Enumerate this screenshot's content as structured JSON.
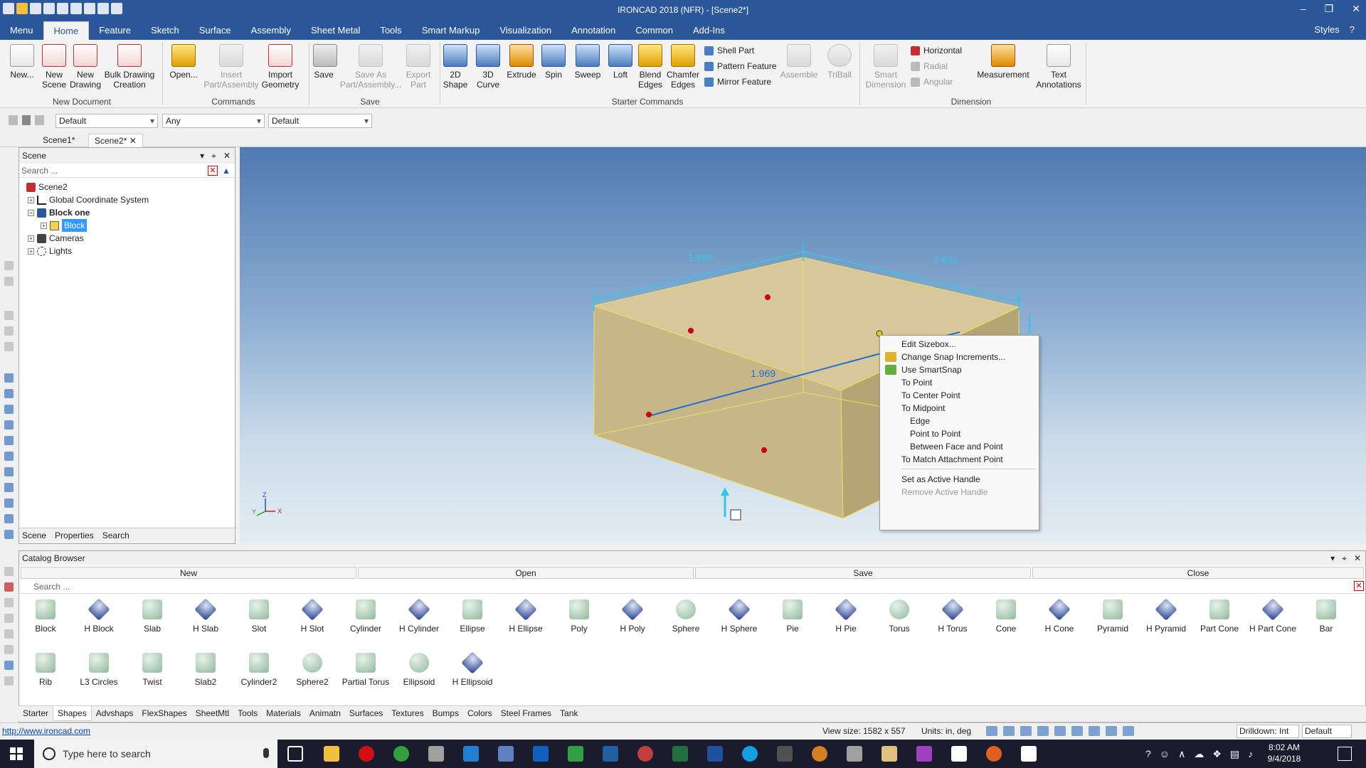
{
  "window": {
    "title": "IRONCAD 2018 (NFR) - [Scene2*]",
    "minimize": "–",
    "restore": "❐",
    "close": "✕"
  },
  "menubar": {
    "tabs": [
      "Menu",
      "Home",
      "Feature",
      "Sketch",
      "Surface",
      "Assembly",
      "Sheet Metal",
      "Tools",
      "Smart Markup",
      "Visualization",
      "Annotation",
      "Common",
      "Add-Ins"
    ],
    "active": "Home",
    "styles_label": "Styles",
    "help_label": "?"
  },
  "ribbon": {
    "new_document": {
      "group": "New Document",
      "new": "New...",
      "new_scene": [
        "New",
        "Scene"
      ],
      "new_drawing": [
        "New",
        "Drawing"
      ],
      "bulk": [
        "Bulk Drawing",
        "Creation"
      ]
    },
    "commands": {
      "group": "Commands",
      "open": "Open...",
      "insert": [
        "Insert",
        "Part/Assembly"
      ],
      "import": [
        "Import",
        "Geometry"
      ]
    },
    "save": {
      "group": "Save",
      "save": "Save",
      "save_as": [
        "Save As",
        "Part/Assembly..."
      ],
      "export": [
        "Export",
        "Part"
      ]
    },
    "starter": {
      "group": "Starter Commands",
      "shape2d": [
        "2D",
        "Shape"
      ],
      "curve3d": [
        "3D",
        "Curve"
      ],
      "extrude": "Extrude",
      "spin": "Spin",
      "sweep": "Sweep",
      "loft": "Loft",
      "blend": [
        "Blend",
        "Edges"
      ],
      "chamfer": [
        "Chamfer",
        "Edges"
      ],
      "shell": "Shell Part",
      "pattern": "Pattern Feature",
      "mirror": "Mirror Feature",
      "assemble": "Assemble",
      "triball": "TriBall"
    },
    "dimension": {
      "group": "Dimension",
      "smart": [
        "Smart",
        "Dimension"
      ],
      "horizontal": "Horizontal",
      "radial": "Radial",
      "angular": "Angular",
      "measurement": "Measurement",
      "text": [
        "Text",
        "Annotations"
      ]
    }
  },
  "toolrow": {
    "combo1": "Default",
    "combo2": "Any",
    "combo3": "Default"
  },
  "doc_tabs": [
    "Scene1*",
    "Scene2*"
  ],
  "scene_panel": {
    "title": "Scene",
    "search_placeholder": "Search ...",
    "tree": {
      "root": "Scene2",
      "gcs": "Global Coordinate System",
      "block_one": "Block one",
      "block": "Block",
      "cameras": "Cameras",
      "lights": "Lights"
    },
    "tabs": [
      "Scene",
      "Properties",
      "Search"
    ]
  },
  "viewport": {
    "dim_top_left": "1.969",
    "dim_top_right": "1.631",
    "dim_center": "1.969",
    "axis_z": "Z",
    "axis_x": "X",
    "axis_y": "Y"
  },
  "context_menu": {
    "edit_sizebox": "Edit Sizebox...",
    "change_snap": "Change Snap Increments...",
    "use_smartsnap": "Use SmartSnap",
    "to_point": "To Point",
    "to_center_point": "To Center Point",
    "to_midpoint": "To Midpoint",
    "edge": "Edge",
    "point_to_point": "Point to Point",
    "between_face_and_point": "Between Face and Point",
    "to_match_attachment": "To Match Attachment Point",
    "set_active_handle": "Set as Active Handle",
    "remove_active_handle": "Remove Active Handle"
  },
  "catalog": {
    "title": "Catalog Browser",
    "new": "New",
    "open": "Open",
    "save": "Save",
    "close": "Close",
    "search_placeholder": "Search ...",
    "shapes_row1": [
      "Block",
      "H Block",
      "Slab",
      "H Slab",
      "Slot",
      "H Slot",
      "Cylinder",
      "H Cylinder",
      "Ellipse",
      "H Ellipse",
      "Poly",
      "H Poly",
      "Sphere",
      "H Sphere",
      "Pie",
      "H Pie",
      "Torus",
      "H Torus",
      "Cone",
      "H Cone",
      "Pyramid",
      "H Pyramid",
      "Part Cone",
      "H Part Cone",
      "Bar"
    ],
    "shapes_row2": [
      "Rib",
      "L3 Circles",
      "Twist",
      "Slab2",
      "Cylinder2",
      "Sphere2",
      "Partial Torus",
      "Ellipsoid",
      "H Ellipsoid"
    ],
    "bottom_tabs": [
      "Starter",
      "Shapes",
      "Advshaps",
      "FlexShapes",
      "SheetMtl",
      "Tools",
      "Materials",
      "Animatn",
      "Surfaces",
      "Textures",
      "Bumps",
      "Colors",
      "Steel Frames",
      "Tank"
    ],
    "active_tab": "Shapes"
  },
  "statusbar": {
    "link": "http://www.ironcad.com",
    "view_size": "View size: 1582 x 557",
    "units": "Units: in, deg",
    "drilldown": "Drilldown: Int",
    "default": "Default"
  },
  "taskbar": {
    "search_placeholder": "Type here to search",
    "time": "8:02 AM",
    "date": "9/4/2018"
  }
}
